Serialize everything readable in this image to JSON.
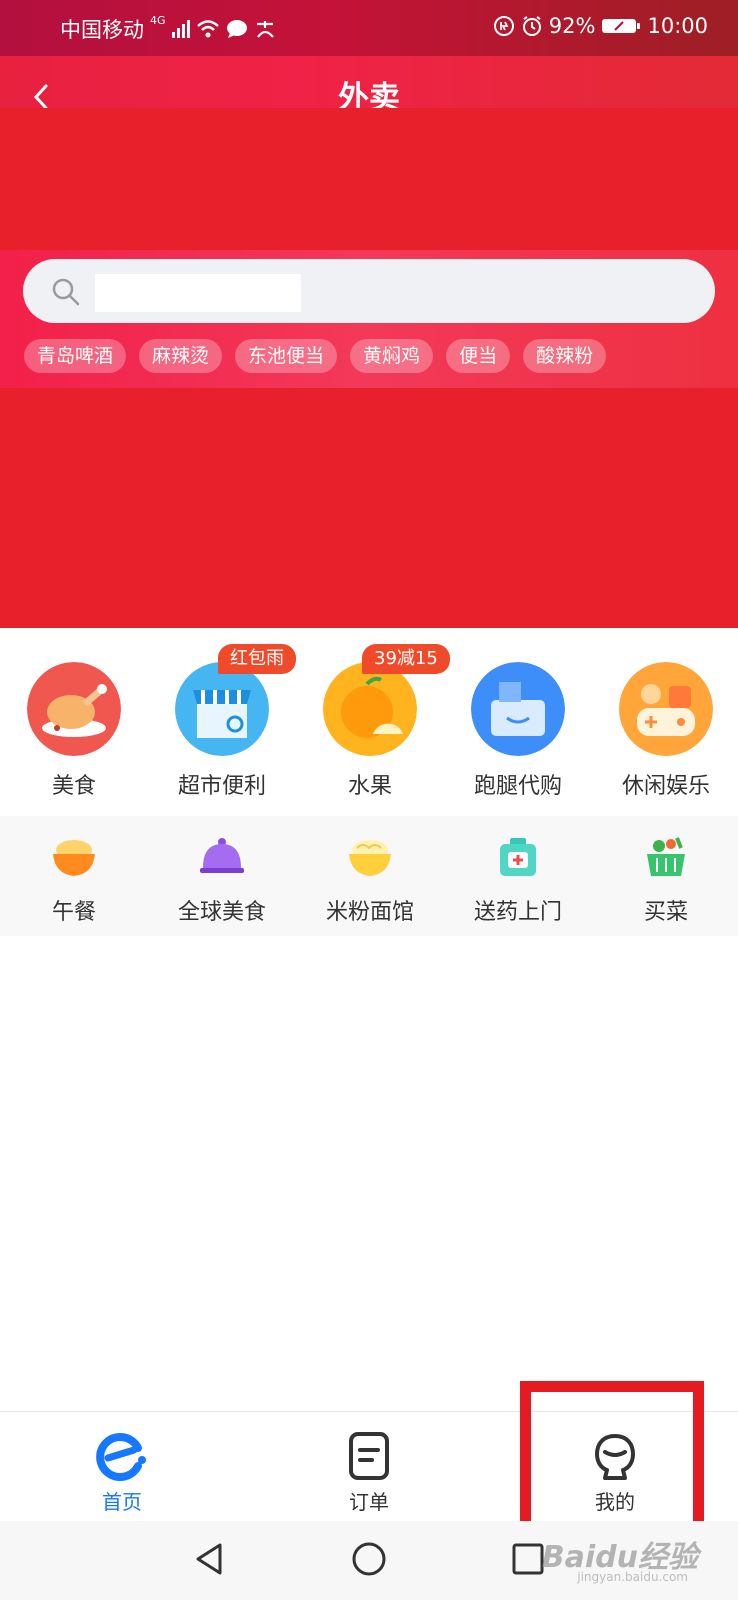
{
  "status_bar": {
    "carrier": "中国移动",
    "network": "4G",
    "battery": "92%",
    "time": "10:00"
  },
  "header": {
    "title": "外卖"
  },
  "search": {
    "placeholder": ""
  },
  "hot_tags": [
    "青岛啤酒",
    "麻辣烫",
    "东池便当",
    "黄焖鸡",
    "便当",
    "酸辣粉"
  ],
  "categories": [
    {
      "label": "美食",
      "icon": "roast-chicken-icon"
    },
    {
      "label": "超市便利",
      "icon": "store-icon",
      "badge": "红包雨"
    },
    {
      "label": "水果",
      "icon": "orange-icon",
      "badge": "39减15"
    },
    {
      "label": "跑腿代购",
      "icon": "delivery-box-icon"
    },
    {
      "label": "休闲娱乐",
      "icon": "game-controller-icon"
    }
  ],
  "sub_categories": [
    {
      "label": "午餐",
      "icon": "rice-bowl-icon"
    },
    {
      "label": "全球美食",
      "icon": "food-cloche-icon"
    },
    {
      "label": "米粉面馆",
      "icon": "noodle-bowl-icon"
    },
    {
      "label": "送药上门",
      "icon": "medicine-kit-icon"
    },
    {
      "label": "买菜",
      "icon": "vegetable-basket-icon"
    }
  ],
  "bottom_nav": [
    {
      "label": "首页",
      "icon": "eleme-logo-icon",
      "active": true
    },
    {
      "label": "订单",
      "icon": "order-note-icon",
      "active": false
    },
    {
      "label": "我的",
      "icon": "profile-face-icon",
      "active": false
    }
  ],
  "colors": {
    "brand_red": "#e8202b",
    "active_blue": "#1677ff",
    "badge_orange": "#ef4b2b"
  },
  "watermark": {
    "text": "Baidu经验",
    "url_text": "jingyan.baidu.com"
  }
}
